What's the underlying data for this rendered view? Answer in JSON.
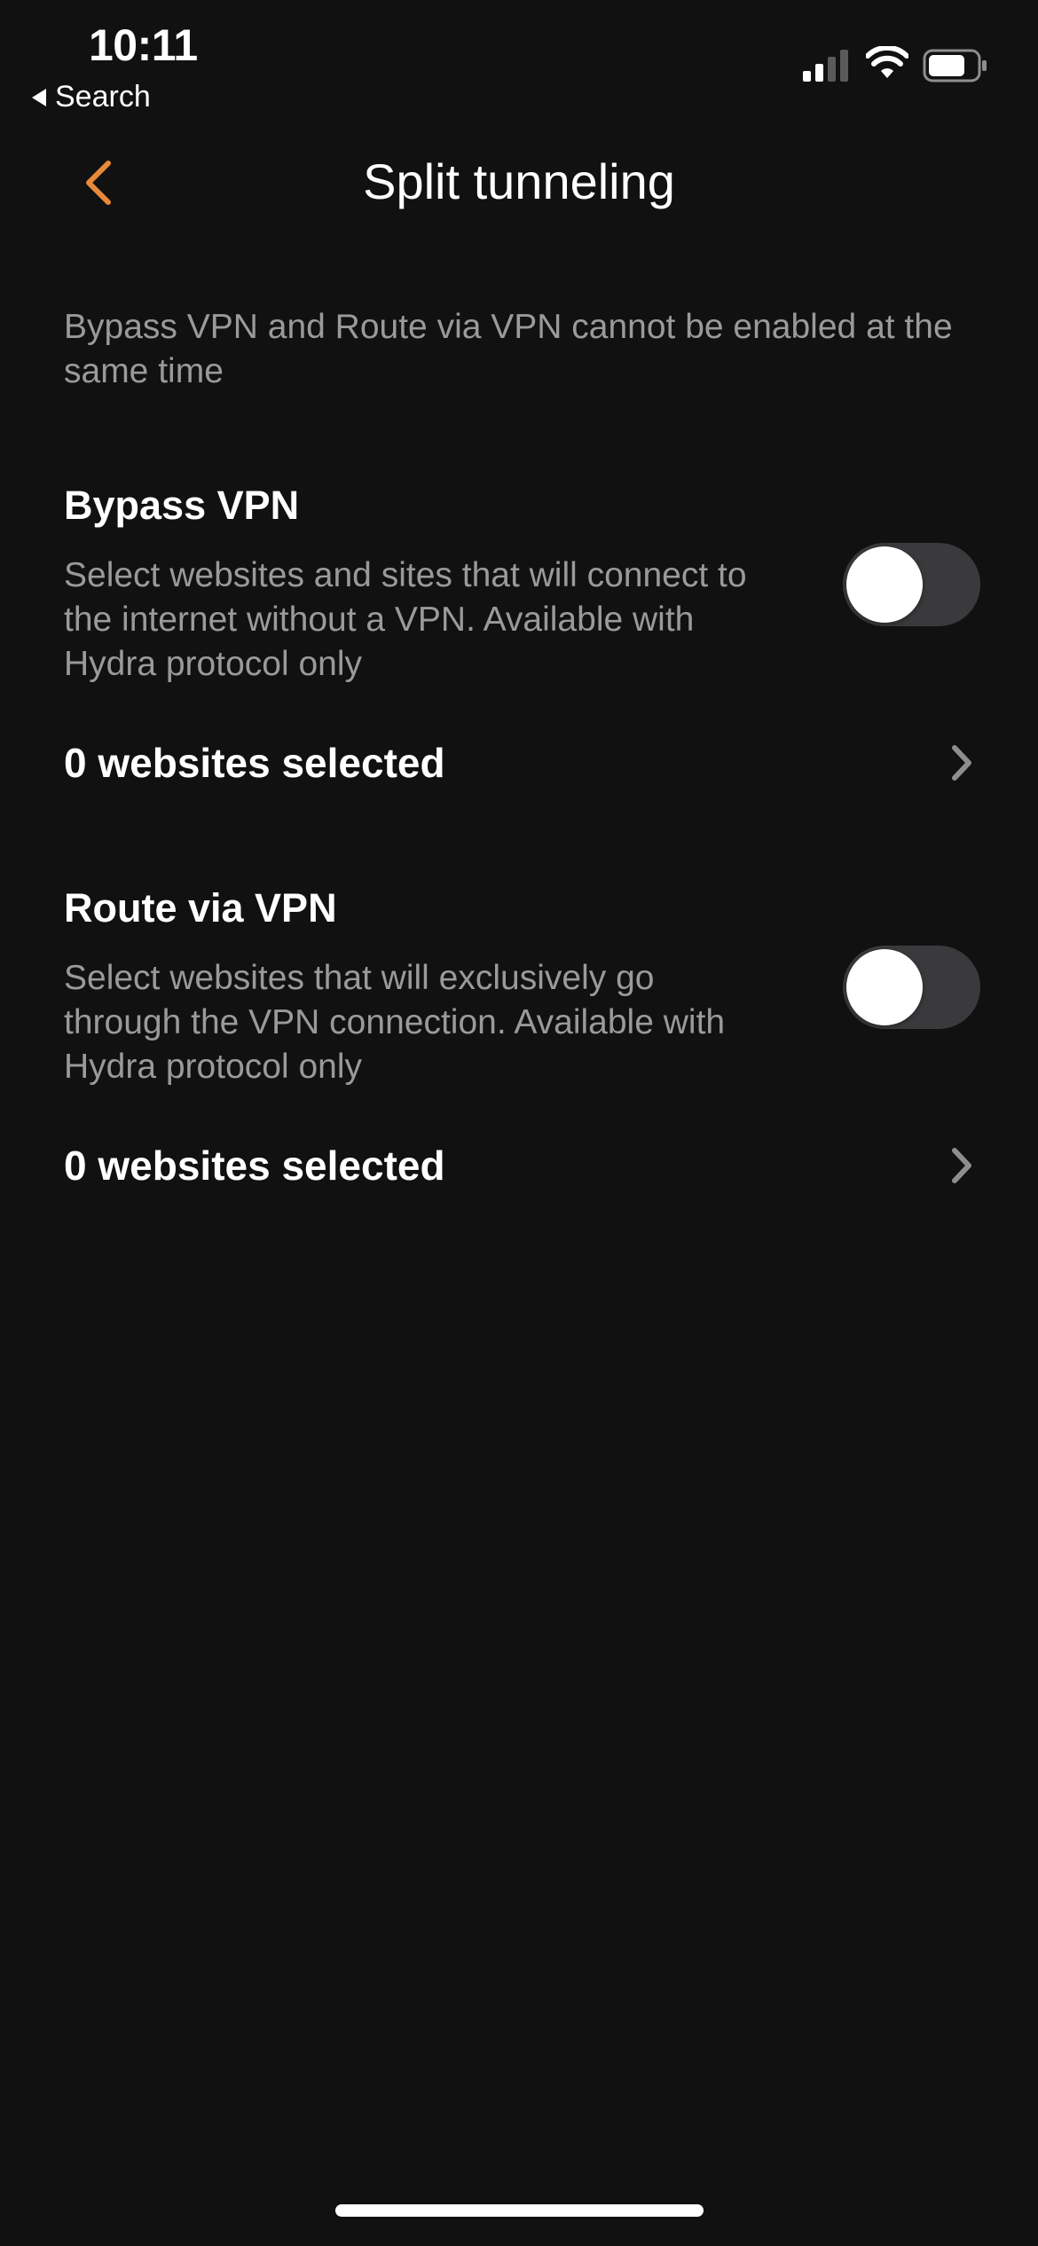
{
  "status_bar": {
    "time": "10:11",
    "back_app_label": "Search"
  },
  "header": {
    "title": "Split tunneling",
    "accent_color": "#E8893A"
  },
  "notice": "Bypass VPN and Route via VPN cannot be enabled at the same time",
  "sections": [
    {
      "title": "Bypass VPN",
      "description": "Select websites and sites that will connect to the internet without a VPN. Available with Hydra protocol only",
      "toggle_on": false,
      "link_label": "0 websites selected"
    },
    {
      "title": "Route via VPN",
      "description": "Select websites that will exclusively go through the VPN connection. Available with Hydra protocol only",
      "toggle_on": false,
      "link_label": "0 websites selected"
    }
  ],
  "icons": {
    "back": "chevron-left-icon",
    "row_arrow": "chevron-right-icon",
    "signal": "cellular-signal-icon",
    "wifi": "wifi-icon",
    "battery": "battery-icon"
  }
}
